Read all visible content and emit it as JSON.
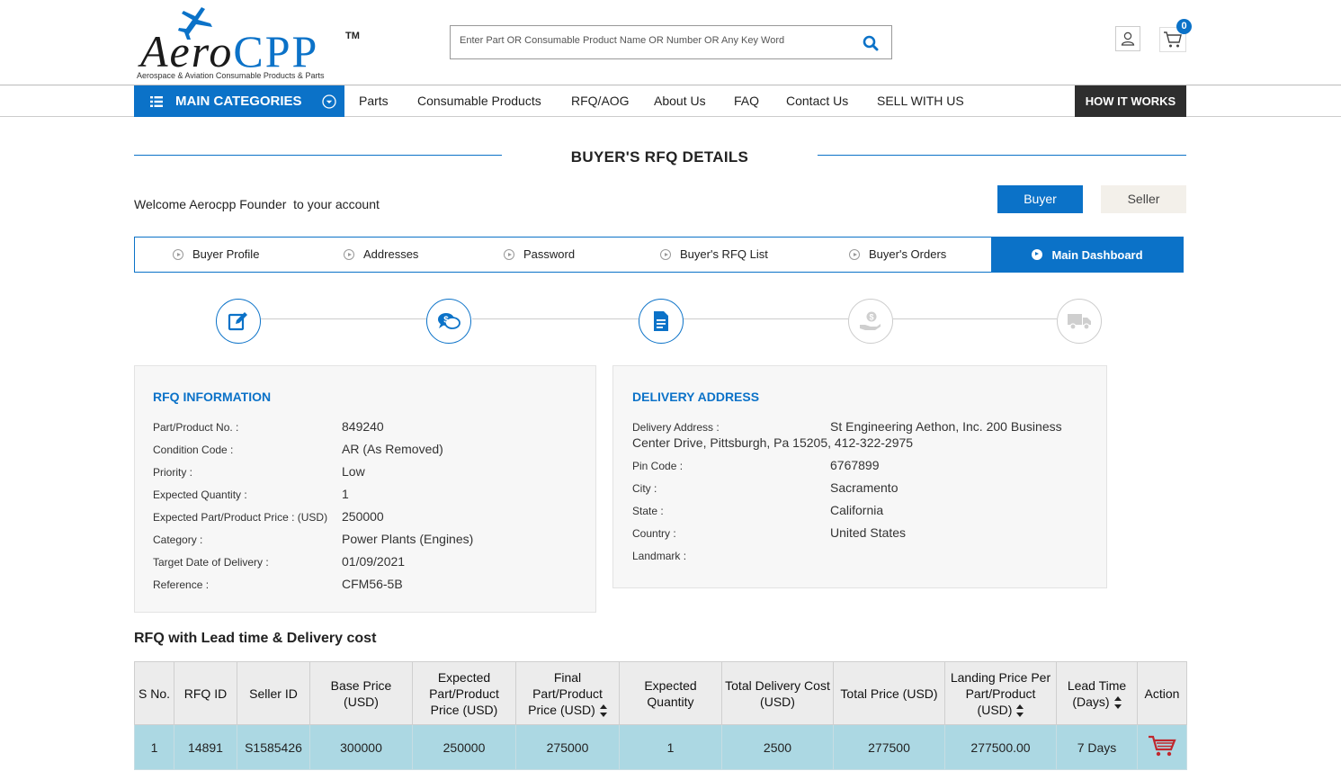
{
  "brand": {
    "name_main": "Aero",
    "name_accent": "CPP",
    "tm": "TM",
    "tagline": "Aerospace & Aviation Consumable Products & Parts"
  },
  "search": {
    "placeholder": "Enter Part OR Consumable Product Name OR Number OR Any Key Word"
  },
  "cart": {
    "count": "0"
  },
  "nav": {
    "categories_label": "MAIN CATEGORIES",
    "items": [
      "Parts",
      "Consumable Products",
      "RFQ/AOG",
      "About Us",
      "FAQ",
      "Contact Us",
      "SELL WITH US"
    ],
    "how_it_works": "HOW IT WORKS"
  },
  "page": {
    "title": "BUYER'S RFQ DETAILS",
    "welcome": "Welcome Aerocpp Founder  to your account",
    "buyer_btn": "Buyer",
    "seller_btn": "Seller"
  },
  "tabs": [
    "Buyer Profile",
    "Addresses",
    "Password",
    "Buyer's RFQ List",
    "Buyer's Orders",
    "Main Dashboard"
  ],
  "rfq_info": {
    "title": "RFQ INFORMATION",
    "rows": [
      {
        "label": "Part/Product No. :",
        "value": "849240"
      },
      {
        "label": "Condition Code :",
        "value": "AR (As Removed)"
      },
      {
        "label": "Priority :",
        "value": "Low"
      },
      {
        "label": "Expected Quantity :",
        "value": "1"
      },
      {
        "label": "Expected Part/Product Price : (USD)",
        "value": "250000"
      },
      {
        "label": "Category :",
        "value": "Power Plants (Engines)"
      },
      {
        "label": "Target Date of Delivery :",
        "value": "01/09/2021"
      },
      {
        "label": "Reference :",
        "value": "CFM56-5B"
      }
    ]
  },
  "delivery": {
    "title": "DELIVERY ADDRESS",
    "address_label": "Delivery Address :",
    "address_line1": "St Engineering Aethon, Inc. 200 Business",
    "address_line2": "Center Drive, Pittsburgh, Pa 15205, 412-322-2975",
    "rows": [
      {
        "label": "Pin Code :",
        "value": "6767899"
      },
      {
        "label": "City :",
        "value": "Sacramento"
      },
      {
        "label": "State :",
        "value": "California"
      },
      {
        "label": "Country :",
        "value": "United States"
      },
      {
        "label": "Landmark :",
        "value": ""
      }
    ]
  },
  "lead_section": {
    "title": "RFQ with Lead time & Delivery cost",
    "headers": [
      "S No.",
      "RFQ ID",
      "Seller ID",
      "Base Price (USD)",
      "Expected Part/Product Price (USD)",
      "Final Part/Product Price (USD)",
      "Expected Quantity",
      "Total Delivery Cost (USD)",
      "Total Price (USD)",
      "Landing Price Per Part/Product (USD)",
      "Lead Time (Days)",
      "Action"
    ],
    "rows": [
      [
        "1",
        "14891",
        "S1585426",
        "300000",
        "250000",
        "275000",
        "1",
        "2500",
        "277500",
        "277500.00",
        "7 Days"
      ]
    ]
  },
  "colors": {
    "accent": "#0b72c8",
    "row_bg": "#acd8e3",
    "dark_button": "#2e2e2e",
    "cart_red": "#c0272d"
  }
}
